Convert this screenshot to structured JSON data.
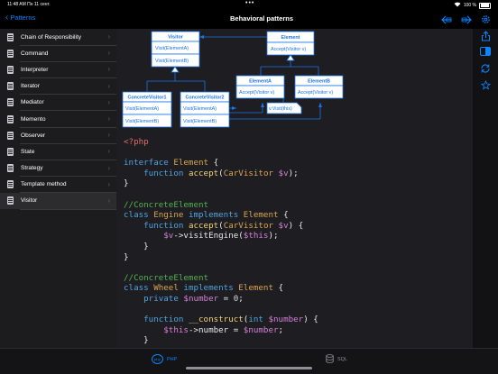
{
  "status": {
    "time": "11:48 AM",
    "date": "Пн 11 сент.",
    "wifi": "wifi-icon",
    "battery": "100 %"
  },
  "nav": {
    "back_label": "Patterns",
    "title": "Behavioral patterns"
  },
  "sidebar": {
    "items": [
      {
        "label": "Chain of Responsibility"
      },
      {
        "label": "Command"
      },
      {
        "label": "Interpreter"
      },
      {
        "label": "Iterator"
      },
      {
        "label": "Mediator"
      },
      {
        "label": "Memento"
      },
      {
        "label": "Observer"
      },
      {
        "label": "State"
      },
      {
        "label": "Strategy"
      },
      {
        "label": "Template method"
      },
      {
        "label": "Visitor"
      }
    ],
    "selected": "Visitor"
  },
  "uml": {
    "visitor": {
      "name": "Visitor",
      "m1": "Visit(ElementA)",
      "m2": "Visit(ElementB)"
    },
    "element": {
      "name": "Element",
      "m1": "Accept(Visitor v)"
    },
    "cv1": {
      "name": "ConcreteVisitor1",
      "m1": "Visit(ElementA)",
      "m2": "Visit(ElementB)"
    },
    "cv2": {
      "name": "ConcreteVisitor2",
      "m1": "Visit(ElementA)",
      "m2": "Visit(ElementB)"
    },
    "ea": {
      "name": "ElementA",
      "m1": "Accept(Visitor v)"
    },
    "eb": {
      "name": "ElementB",
      "m1": "Accept(Visitor v)"
    },
    "note": "v.Visit(this)"
  },
  "code": [
    [
      {
        "c": "php",
        "t": "<?php"
      }
    ],
    [],
    [
      {
        "c": "kw",
        "t": "interface "
      },
      {
        "c": "ty",
        "t": "Element "
      },
      {
        "c": "pl",
        "t": "{"
      }
    ],
    [
      {
        "c": "pl",
        "t": "    "
      },
      {
        "c": "kw",
        "t": "function "
      },
      {
        "c": "fn",
        "t": "accept"
      },
      {
        "c": "pl",
        "t": "("
      },
      {
        "c": "ty",
        "t": "CarVisitor "
      },
      {
        "c": "vr",
        "t": "$v"
      },
      {
        "c": "pl",
        "t": ");"
      }
    ],
    [
      {
        "c": "pl",
        "t": "}"
      }
    ],
    [],
    [
      {
        "c": "cm",
        "t": "//ConcreteElement"
      }
    ],
    [
      {
        "c": "kw",
        "t": "class "
      },
      {
        "c": "ty",
        "t": "Engine "
      },
      {
        "c": "kw",
        "t": "implements "
      },
      {
        "c": "ty",
        "t": "Element "
      },
      {
        "c": "pl",
        "t": "{"
      }
    ],
    [
      {
        "c": "pl",
        "t": "    "
      },
      {
        "c": "kw",
        "t": "function "
      },
      {
        "c": "fn",
        "t": "accept"
      },
      {
        "c": "pl",
        "t": "("
      },
      {
        "c": "ty",
        "t": "CarVisitor "
      },
      {
        "c": "vr",
        "t": "$v"
      },
      {
        "c": "pl",
        "t": ") {"
      }
    ],
    [
      {
        "c": "pl",
        "t": "        "
      },
      {
        "c": "vr",
        "t": "$v"
      },
      {
        "c": "pl",
        "t": "->visitEngine("
      },
      {
        "c": "vr",
        "t": "$this"
      },
      {
        "c": "pl",
        "t": ");"
      }
    ],
    [
      {
        "c": "pl",
        "t": "    }"
      }
    ],
    [
      {
        "c": "pl",
        "t": "}"
      }
    ],
    [],
    [
      {
        "c": "cm",
        "t": "//ConcreteElement"
      }
    ],
    [
      {
        "c": "kw",
        "t": "class "
      },
      {
        "c": "ty",
        "t": "Wheel "
      },
      {
        "c": "kw",
        "t": "implements "
      },
      {
        "c": "ty",
        "t": "Element "
      },
      {
        "c": "pl",
        "t": "{"
      }
    ],
    [
      {
        "c": "pl",
        "t": "    "
      },
      {
        "c": "kw",
        "t": "private "
      },
      {
        "c": "vr",
        "t": "$number "
      },
      {
        "c": "pl",
        "t": "= "
      },
      {
        "c": "nm",
        "t": "0"
      },
      {
        "c": "pl",
        "t": ";"
      }
    ],
    [],
    [
      {
        "c": "pl",
        "t": "    "
      },
      {
        "c": "kw",
        "t": "function "
      },
      {
        "c": "fn",
        "t": "__construct"
      },
      {
        "c": "pl",
        "t": "("
      },
      {
        "c": "kw",
        "t": "int "
      },
      {
        "c": "vr",
        "t": "$number"
      },
      {
        "c": "pl",
        "t": ") {"
      }
    ],
    [
      {
        "c": "pl",
        "t": "        "
      },
      {
        "c": "vr",
        "t": "$this"
      },
      {
        "c": "pl",
        "t": "->number = "
      },
      {
        "c": "vr",
        "t": "$number"
      },
      {
        "c": "pl",
        "t": ";"
      }
    ],
    [
      {
        "c": "pl",
        "t": "    }"
      }
    ]
  ],
  "rail": {
    "icons": [
      "share-icon",
      "sidebar-toggle-icon",
      "refresh-icon",
      "star-icon"
    ]
  },
  "nav_icons": [
    "arrow-back-icon",
    "arrow-forward-icon",
    "settings-icon"
  ],
  "tabs": [
    {
      "label": "PHP",
      "icon_text": "php",
      "active": true
    },
    {
      "label": "SQL",
      "icon_text": "",
      "active": false
    }
  ],
  "colors": {
    "accent": "#0a84ff",
    "keyword": "#4fa3e0",
    "comment": "#54b054",
    "function": "#f1d27a",
    "variable": "#d47fd6",
    "type": "#d9a450",
    "php_tag": "#e06c6c"
  }
}
